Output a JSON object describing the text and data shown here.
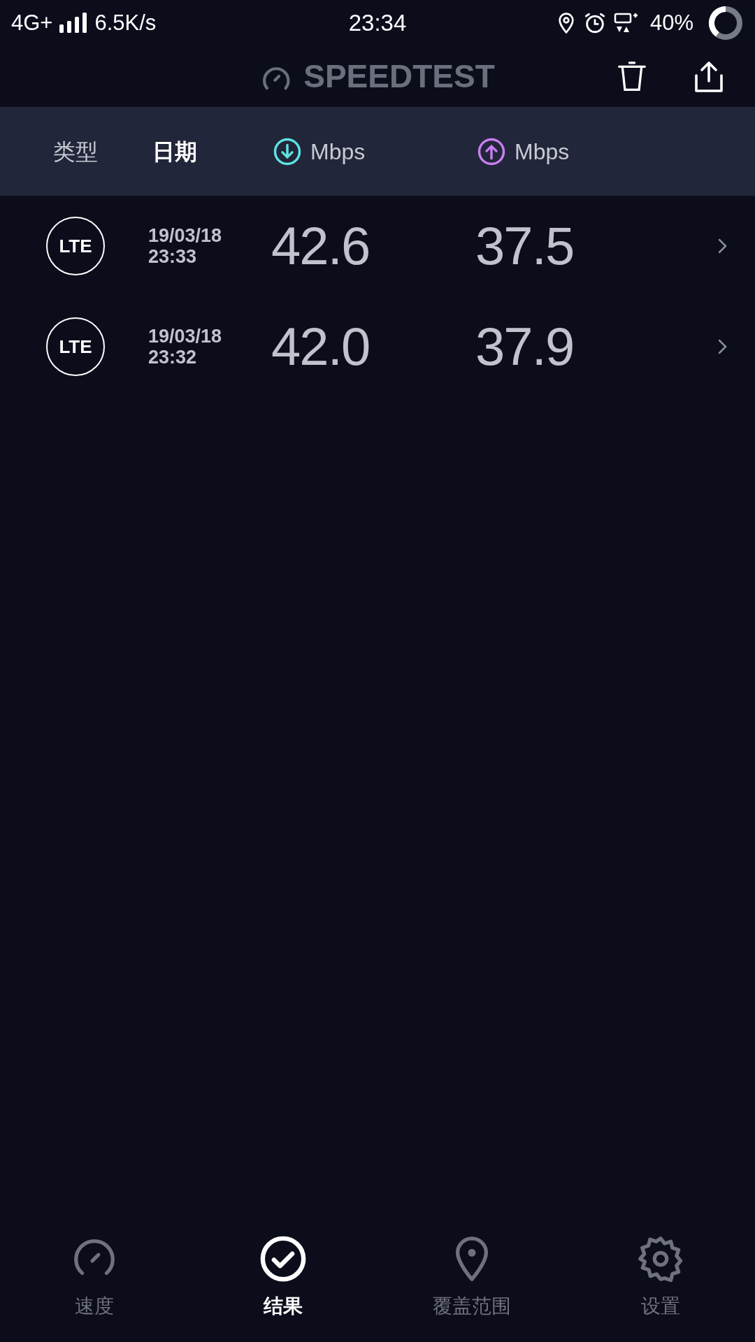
{
  "status_bar": {
    "network": "4G+",
    "speed": "6.5K/s",
    "time": "23:34",
    "battery": "40%"
  },
  "header": {
    "title": "SPEEDTEST"
  },
  "columns": [
    {
      "label": "类型",
      "selected": false,
      "kind": "text"
    },
    {
      "label": "日期",
      "selected": true,
      "kind": "text"
    },
    {
      "label": "Mbps",
      "selected": false,
      "kind": "download"
    },
    {
      "label": "Mbps",
      "selected": false,
      "kind": "upload"
    }
  ],
  "results": [
    {
      "type": "LTE",
      "date": "19/03/18",
      "time": "23:33",
      "download": "42.6",
      "upload": "37.5"
    },
    {
      "type": "LTE",
      "date": "19/03/18",
      "time": "23:32",
      "download": "42.0",
      "upload": "37.9"
    }
  ],
  "nav": [
    {
      "label": "速度",
      "selected": false,
      "kind": "speed"
    },
    {
      "label": "结果",
      "selected": true,
      "kind": "results"
    },
    {
      "label": "覆盖范围",
      "selected": false,
      "kind": "coverage"
    },
    {
      "label": "设置",
      "selected": false,
      "kind": "settings"
    }
  ]
}
